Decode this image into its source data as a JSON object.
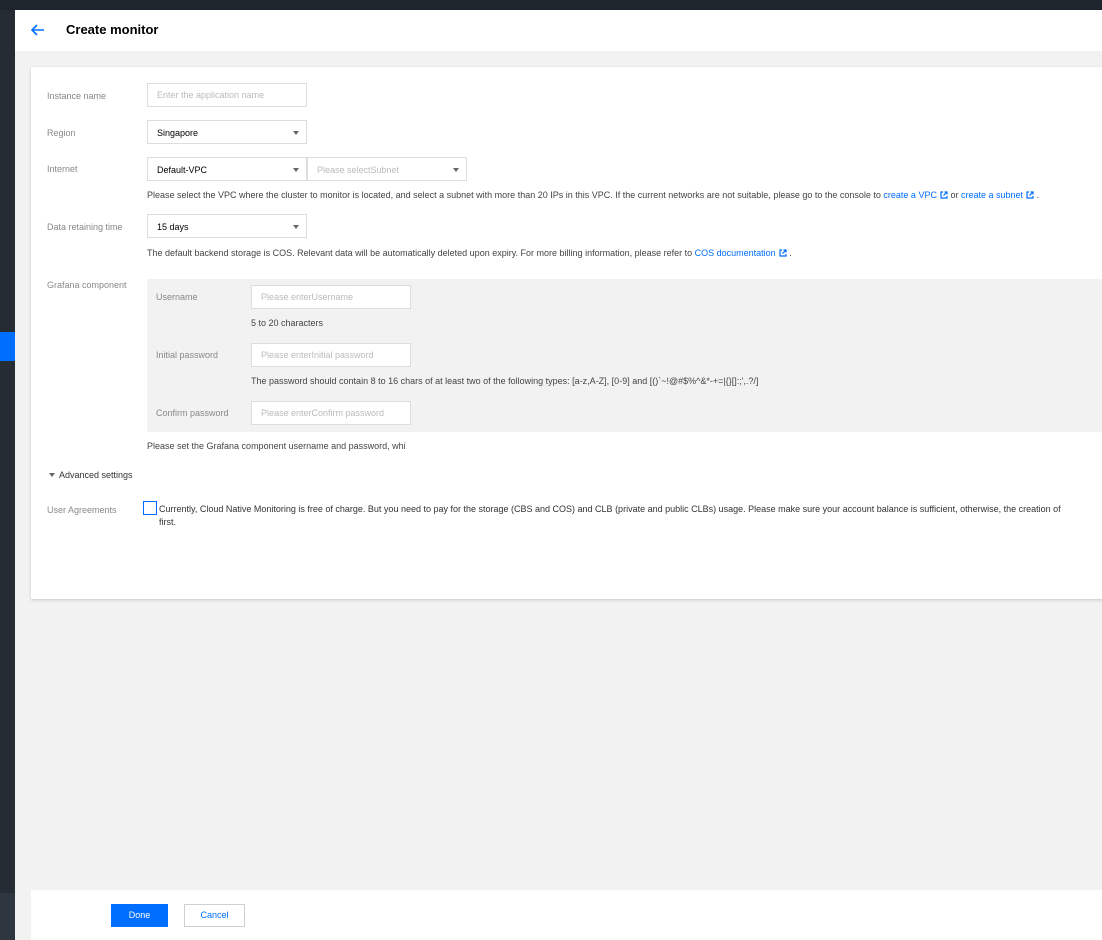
{
  "header": {
    "title": "Create monitor",
    "back_icon": "arrow-left-icon"
  },
  "form": {
    "instance_name": {
      "label": "Instance name",
      "placeholder": "Enter the application name"
    },
    "region": {
      "label": "Region",
      "value": "Singapore"
    },
    "internet": {
      "label": "Internet",
      "vpc_value": "Default-VPC",
      "subnet_placeholder": "Please selectSubnet",
      "help_prefix": "Please select the VPC where the cluster to monitor is located, and select a subnet with more than 20 IPs in this VPC. If the current networks are not suitable, please go to the console to",
      "link_vpc": "create a VPC",
      "help_or": "or",
      "link_subnet": "create a subnet",
      "help_suffix": "."
    },
    "data_retaining": {
      "label": "Data retaining time",
      "value": "15 days",
      "help_prefix": "The default backend storage is COS. Relevant data will be automatically deleted upon expiry. For more billing information, please refer to",
      "link_cos": "COS documentation",
      "help_suffix": "."
    },
    "grafana": {
      "label": "Grafana component",
      "username_label": "Username",
      "username_placeholder": "Please enterUsername",
      "username_help": "5 to 20 characters",
      "password_label": "Initial password",
      "password_placeholder": "Please enterInitial password",
      "password_help": "The password should contain 8 to 16 chars of at least two of the following types: [a-z,A-Z], [0-9] and [()`~!@#$%^&*-+=|{}[]:;',.?/]",
      "confirm_label": "Confirm password",
      "confirm_placeholder": "Please enterConfirm password",
      "note": "Please set the Grafana component username and password, whi"
    },
    "advanced": {
      "label": "Advanced settings"
    },
    "agreement": {
      "label": "User Agreements",
      "line1": "Currently, Cloud Native Monitoring is free of charge. But you need to pay for the storage (CBS and COS) and CLB (private and public CLBs) usage. Please make sure your account balance is sufficient, otherwise, the creation of",
      "line2": "first.",
      "checked": false
    }
  },
  "footer": {
    "done_label": "Done",
    "cancel_label": "Cancel"
  },
  "colors": {
    "accent": "#006eff",
    "sidebar": "#252c34",
    "page_bg": "#f2f2f2"
  }
}
